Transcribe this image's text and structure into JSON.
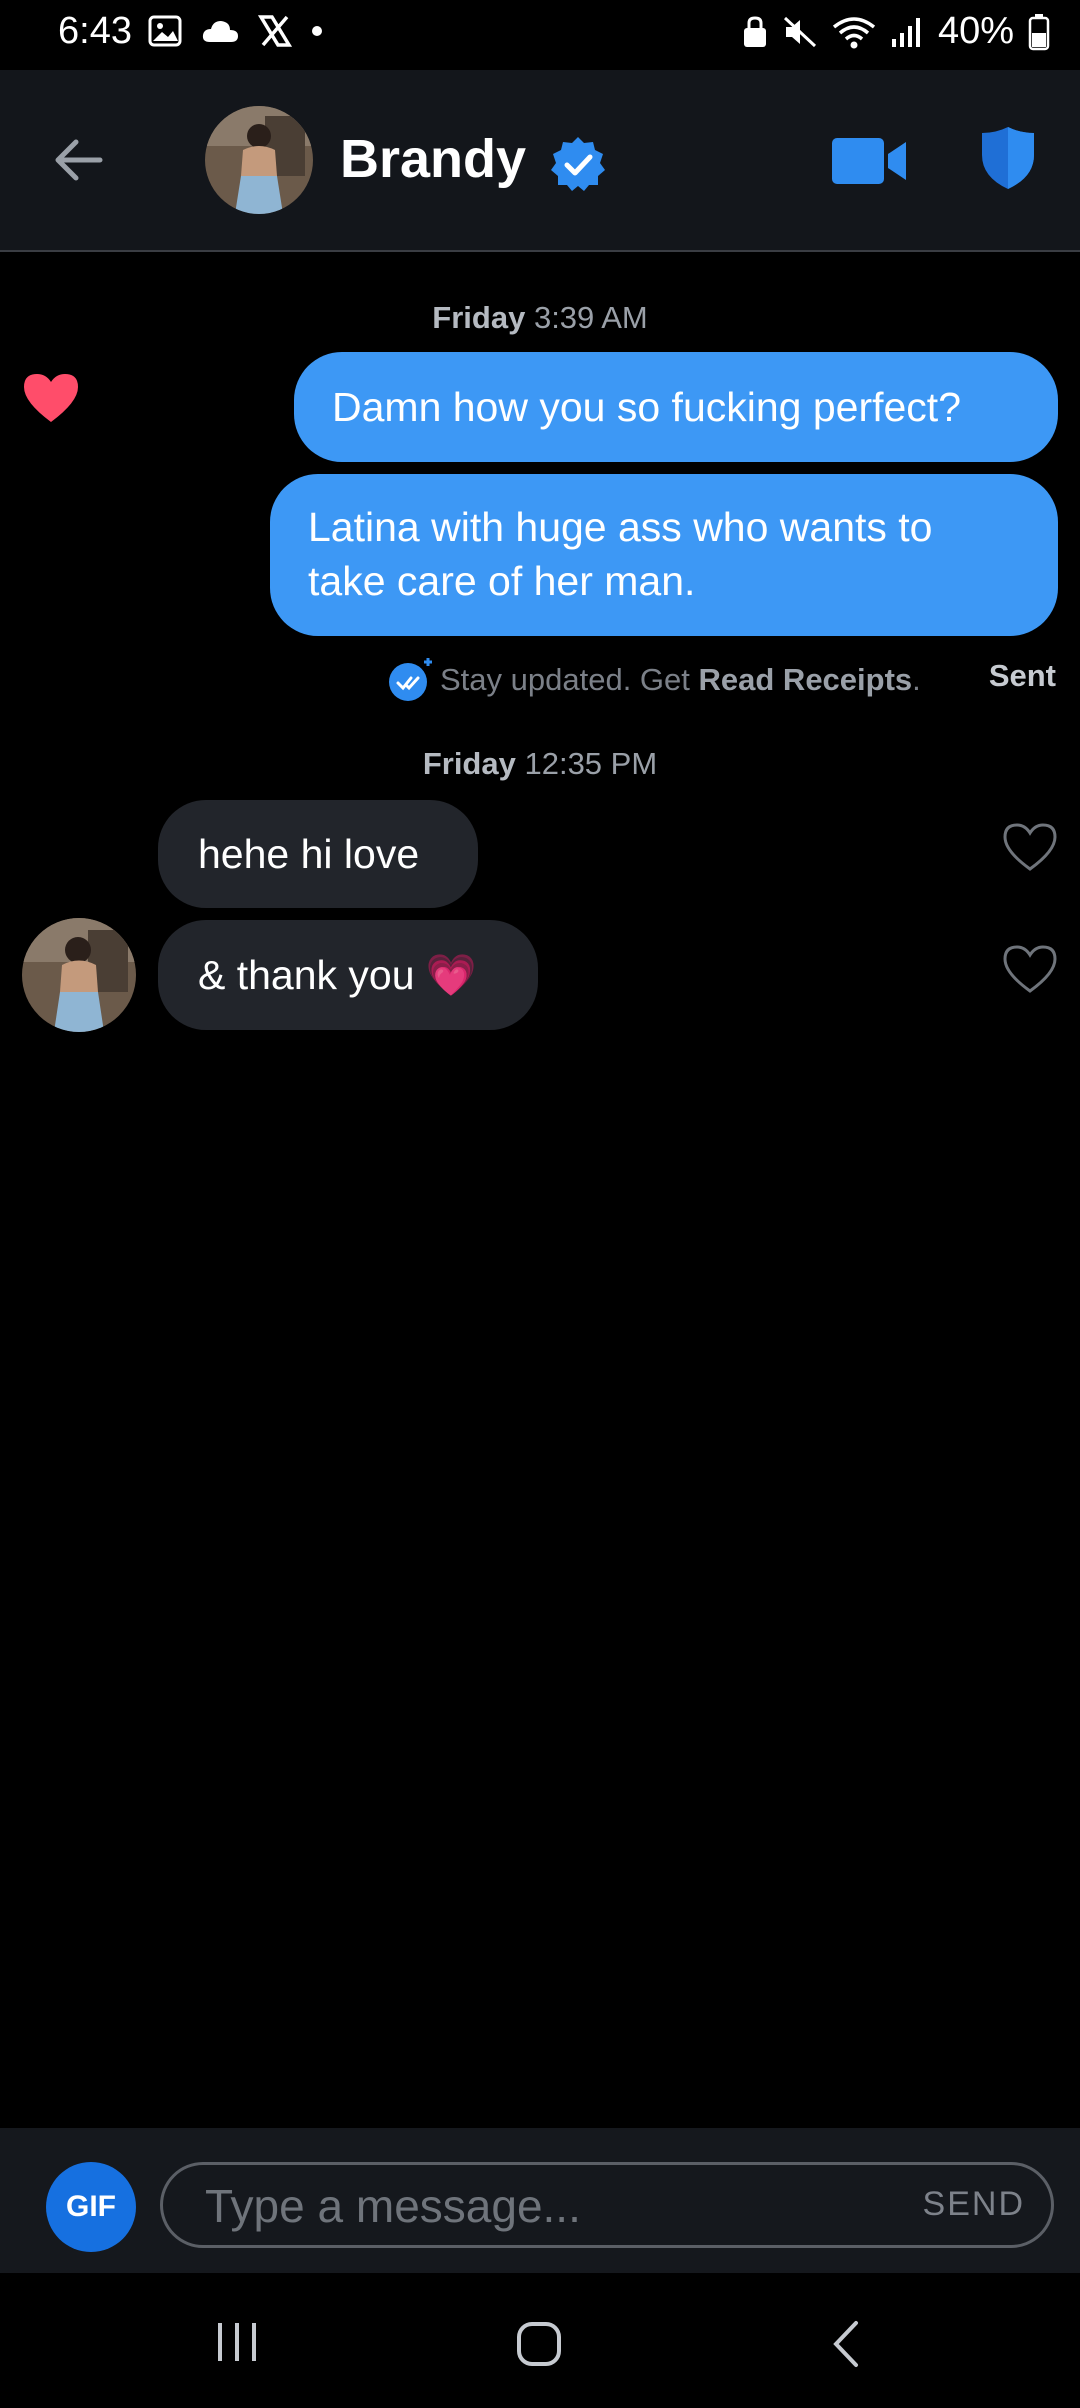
{
  "status_bar": {
    "time": "6:43",
    "battery": "40%",
    "icons": [
      "image-icon",
      "cloud-icon",
      "x-logo-icon",
      "dot-icon",
      "lock-icon",
      "mute-icon",
      "wifi-icon",
      "signal-icon",
      "battery-icon"
    ]
  },
  "header": {
    "contact_name": "Brandy",
    "back_icon": "arrow-left-icon",
    "verified_icon": "verified-badge-icon",
    "video_icon": "video-camera-icon",
    "shield_icon": "shield-icon"
  },
  "conversation": {
    "group1": {
      "day": "Friday",
      "time": "3:39 AM"
    },
    "outgoing": [
      {
        "text": "Damn how you so fucking perfect?",
        "liked": true
      },
      {
        "text": "Latina with huge ass who wants to take care of her man.",
        "liked": false
      }
    ],
    "receipt": {
      "prefix": "Stay updated. Get ",
      "link": "Read Receipts",
      "suffix": ".",
      "status": "Sent"
    },
    "group2": {
      "day": "Friday",
      "time": "12:35 PM"
    },
    "incoming": [
      {
        "text": "hehe hi love",
        "liked": false
      },
      {
        "text": "& thank you 💗",
        "liked": false
      }
    ]
  },
  "composer": {
    "gif_label": "GIF",
    "placeholder": "Type a message...",
    "send_label": "SEND"
  },
  "colors": {
    "accent": "#3d98f5",
    "heart": "#ff4d6a",
    "bubble_in": "#22252b",
    "background": "#000000"
  }
}
